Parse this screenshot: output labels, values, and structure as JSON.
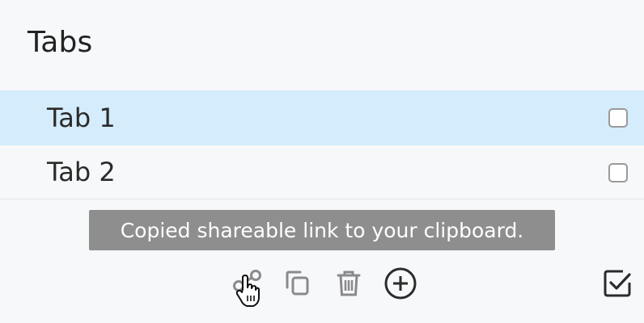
{
  "panel": {
    "title": "Tabs"
  },
  "tabs": [
    {
      "label": "Tab 1",
      "active": true,
      "checked": false
    },
    {
      "label": "Tab 2",
      "active": false,
      "checked": false
    }
  ],
  "toast": {
    "message": "Copied shareable link to your clipboard."
  },
  "toolbar": {
    "icons": [
      "share-icon",
      "duplicate-icon",
      "trash-icon",
      "add-circle-icon",
      "select-all-icon"
    ]
  },
  "colors": {
    "active_row": "#d4ecfb",
    "toast_bg": "#8e8e8e",
    "icon_muted": "#8a8a8a",
    "icon_dark": "#2b2b2b"
  }
}
